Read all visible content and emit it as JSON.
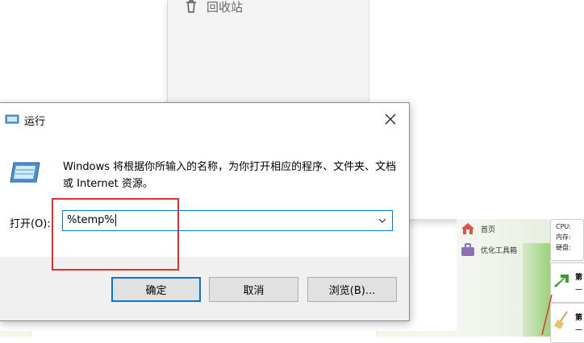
{
  "background": {
    "recycle_label": "回收站"
  },
  "app": {
    "nav_home": "首页",
    "nav_optimize": "优化工具箱",
    "info_cpu": "CPU:",
    "info_memory": "内存:",
    "info_disk": "硬盘:",
    "tile1_label": "第",
    "tile1_sub": "一",
    "tile2_label": "第",
    "tile2_sub": "一"
  },
  "dialog": {
    "title": "运行",
    "description": "Windows 将根据你所输入的名称，为你打开相应的程序、文件夹、文档或 Internet 资源。",
    "open_label": "打开(O):",
    "input_value": "%temp%",
    "ok_label": "确定",
    "cancel_label": "取消",
    "browse_label": "浏览(B)..."
  },
  "colors": {
    "accent": "#0078d7",
    "annotation": "#e62e2e",
    "dialog_bg": "#f0f0f0"
  }
}
